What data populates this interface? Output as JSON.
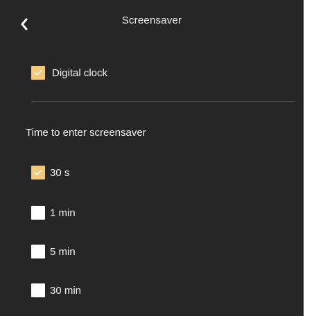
{
  "header": {
    "title": "Screensaver",
    "back_icon": "chevron-left-icon"
  },
  "digital_clock": {
    "label": "Digital clock",
    "checked": true
  },
  "section": {
    "heading": "Time to enter screensaver"
  },
  "time_options": [
    {
      "label": "30 s",
      "checked": true
    },
    {
      "label": "1 min",
      "checked": false
    },
    {
      "label": "5 min",
      "checked": false
    },
    {
      "label": "30 min",
      "checked": false
    }
  ],
  "colors": {
    "background": "#262626",
    "accent": "#f2c979",
    "text": "#f2f2f2",
    "divider": "#4a4a4a"
  }
}
